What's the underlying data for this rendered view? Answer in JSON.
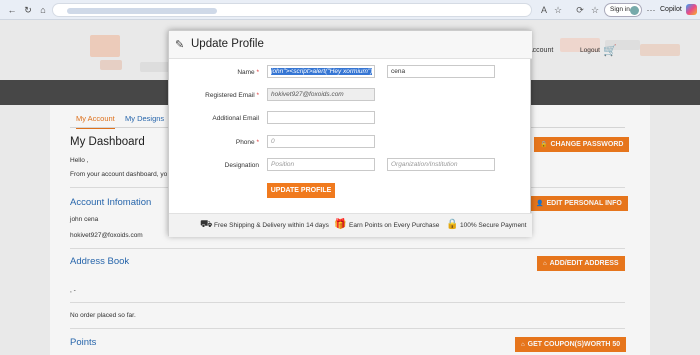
{
  "browser": {
    "signin_label": "Sign in",
    "copilot_label": "Copilot"
  },
  "header": {
    "account_label": "Account",
    "logout_label": "Logout"
  },
  "tabs": [
    {
      "label": "My Account"
    },
    {
      "label": "My Designs"
    }
  ],
  "dashboard": {
    "title": "My Dashboard",
    "hello": "Hello ,",
    "intro": "From your account dashboard, yo",
    "change_password": "CHANGE PASSWORD"
  },
  "account_info": {
    "title": "Account Infomation",
    "name": "john cena",
    "email": "hokivet927@foxoids.com",
    "edit_button": "EDIT PERSONAL INFO"
  },
  "address_book": {
    "title": "Address Book",
    "address": ", -",
    "edit_button": "ADD/EDIT ADDRESS",
    "no_orders": "No order placed so far."
  },
  "points": {
    "title": "Points",
    "button": "GET COUPON(S)WORTH 50"
  },
  "modal": {
    "title": "Update Profile",
    "name_label": "Name",
    "first_name_value": "john\"><script>alert(\"Hey xormium\")",
    "last_name_value": "cena",
    "reg_email_label": "Registered Email",
    "reg_email_value": "hokivet927@foxoids.com",
    "add_email_label": "Additional Email",
    "add_email_value": "",
    "phone_label": "Phone",
    "phone_value": "0",
    "designation_label": "Designation",
    "position_placeholder": "Position",
    "organization_placeholder": "Organization/Institution",
    "update_button": "UPDATE PROFILE",
    "footer": {
      "shipping": "Free Shipping & Delivery within 14 days",
      "points": "Earn Points on Every Purchase",
      "secure": "100% Secure Payment"
    }
  },
  "colors": {
    "accent": "#f07a1e",
    "link": "#2a6bb3",
    "dark_bar": "#4a4a4a"
  }
}
